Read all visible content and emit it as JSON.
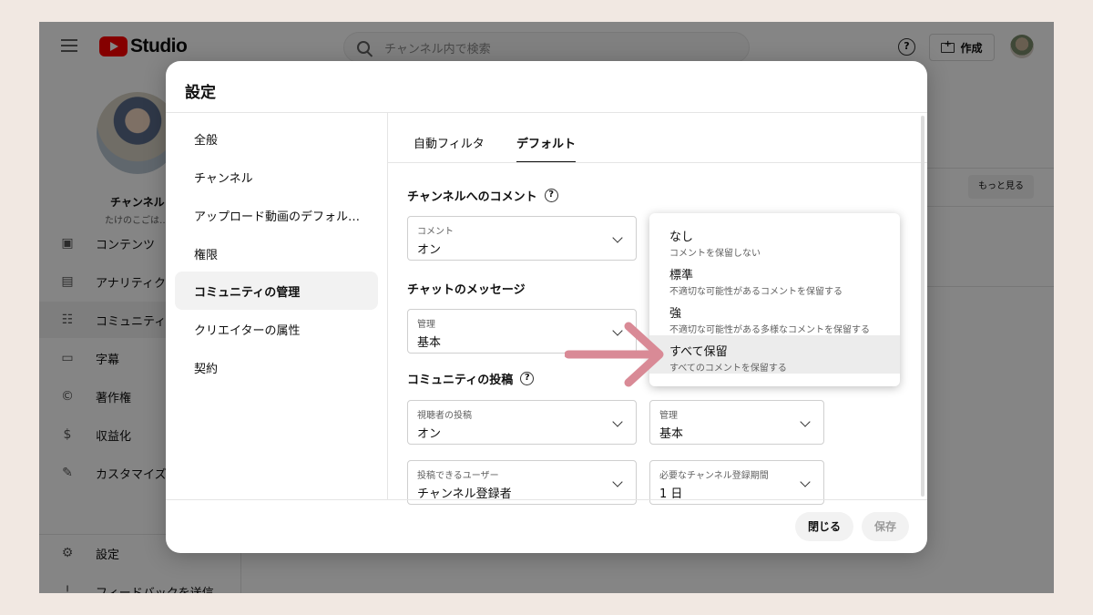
{
  "topbar": {
    "logo_text": "Studio",
    "search_placeholder": "チャンネル内で検索",
    "help_symbol": "?",
    "create_label": "作成"
  },
  "sidebar": {
    "channel_name": "チャンネル",
    "channel_sub": "たけのこごは…",
    "items": [
      {
        "icon": "content-icon",
        "label": "コンテンツ"
      },
      {
        "icon": "analytics-icon",
        "label": "アナリティク"
      },
      {
        "icon": "community-icon",
        "label": "コミュニティ"
      },
      {
        "icon": "subtitles-icon",
        "label": "字幕"
      },
      {
        "icon": "copyright-icon",
        "label": "著作権"
      },
      {
        "icon": "monetization-icon",
        "label": "収益化"
      },
      {
        "icon": "customize-icon",
        "label": "カスタマイズ"
      }
    ],
    "bottom": [
      {
        "icon": "gear-icon",
        "label": "設定"
      },
      {
        "icon": "feedback-icon",
        "label": "フィードバックを送信"
      }
    ]
  },
  "background": {
    "more_label": "もっと見る"
  },
  "modal": {
    "title": "設定",
    "menu": [
      "全般",
      "チャンネル",
      "アップロード動画のデフォル…",
      "権限",
      "コミュニティの管理",
      "クリエイターの属性",
      "契約"
    ],
    "active_menu": "コミュニティの管理",
    "tabs": [
      "自動フィルタ",
      "デフォルト"
    ],
    "active_tab": "デフォルト",
    "section_comments": "チャンネルへのコメント",
    "comment_select": {
      "label": "コメント",
      "value": "オン"
    },
    "section_chat": "チャットのメッセージ",
    "chat_select": {
      "label": "管理",
      "value": "基本"
    },
    "section_posts": "コミュニティの投稿",
    "viewer_posts_select": {
      "label": "視聴者の投稿",
      "value": "オン"
    },
    "posts_manage_select": {
      "label": "管理",
      "value": "基本"
    },
    "posters_select": {
      "label": "投稿できるユーザー",
      "value": "チャンネル登録者"
    },
    "period_select": {
      "label": "必要なチャンネル登録期間",
      "value": "1 日"
    },
    "dropdown_options": [
      {
        "title": "なし",
        "desc": "コメントを保留しない"
      },
      {
        "title": "標準",
        "desc": "不適切な可能性があるコメントを保留する"
      },
      {
        "title": "強",
        "desc": "不適切な可能性がある多様なコメントを保留する"
      },
      {
        "title": "すべて保留",
        "desc": "すべてのコメントを保留する"
      }
    ],
    "selected_option": "すべて保留",
    "close_label": "閉じる",
    "save_label": "保存"
  },
  "colors": {
    "page_background": "#f1e8e2",
    "brand_red": "#ff0000",
    "arrow_pink": "#d98a96"
  }
}
